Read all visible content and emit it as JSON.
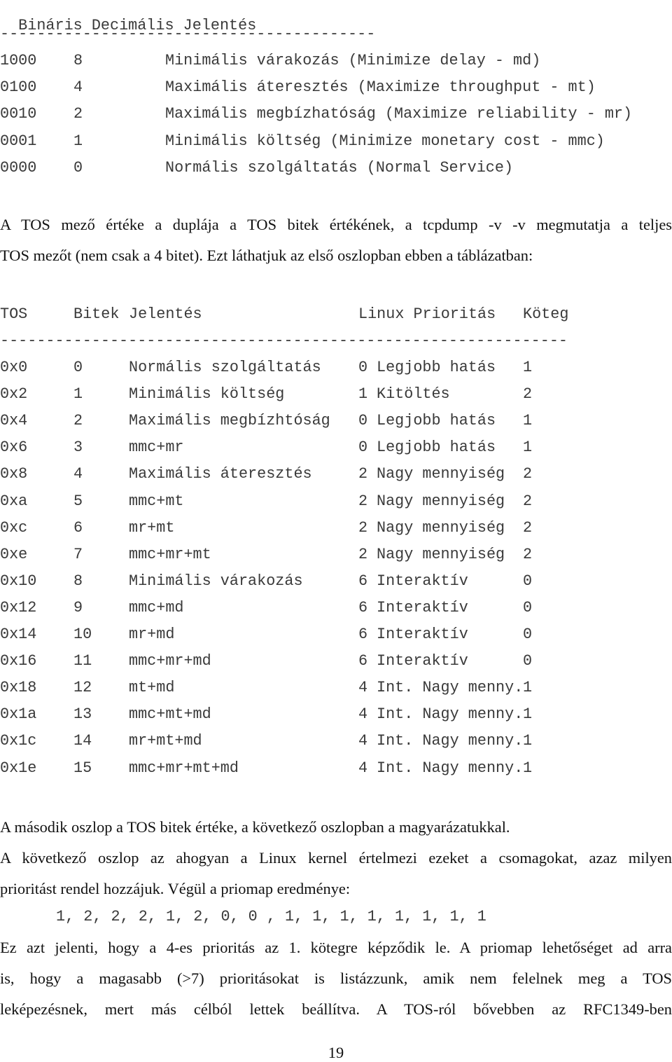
{
  "table1": {
    "headers": [
      "Bináris",
      "Decimális",
      "Jelentés"
    ],
    "separator": "-----------------------------------------",
    "rows": [
      {
        "binary": "1000",
        "decimal": "8",
        "meaning": "Minimális várakozás (Minimize delay - md)"
      },
      {
        "binary": "0100",
        "decimal": "4",
        "meaning": "Maximális áteresztés (Maximize throughput - mt)"
      },
      {
        "binary": "0010",
        "decimal": "2",
        "meaning": "Maximális megbízhatóság (Maximize reliability - mr)"
      },
      {
        "binary": "0001",
        "decimal": "1",
        "meaning": "Minimális költség (Minimize monetary cost - mmc)"
      },
      {
        "binary": "0000",
        "decimal": "0",
        "meaning": "Normális szolgáltatás (Normal Service)"
      }
    ]
  },
  "paragraph1": {
    "line1": "A TOS mező értéke a duplája a TOS bitek értékének, a tcpdump -v -v megmutatja a teljes",
    "line2": "TOS mezőt (nem csak a 4 bitet). Ezt láthatjuk az első oszlopban ebben a táblázatban:"
  },
  "table2": {
    "headers": {
      "tos": "TOS",
      "bits": "Bitek",
      "meaning": "Jelentés",
      "priority": "Linux Prioritás",
      "band": "Köteg"
    },
    "separator": "--------------------------------------------------------------",
    "rows": [
      {
        "tos": "0x0",
        "bits": "0",
        "meaning": "Normális szolgáltatás",
        "prio": "0",
        "prio_name": "Legjobb hatás",
        "band": "1"
      },
      {
        "tos": "0x2",
        "bits": "1",
        "meaning": "Minimális költség",
        "prio": "1",
        "prio_name": "Kitöltés",
        "band": "2"
      },
      {
        "tos": "0x4",
        "bits": "2",
        "meaning": "Maximális megbízhtóság",
        "prio": "0",
        "prio_name": "Legjobb hatás",
        "band": "1"
      },
      {
        "tos": "0x6",
        "bits": "3",
        "meaning": "mmc+mr",
        "prio": "0",
        "prio_name": "Legjobb hatás",
        "band": "1"
      },
      {
        "tos": "0x8",
        "bits": "4",
        "meaning": "Maximális áteresztés",
        "prio": "2",
        "prio_name": "Nagy mennyiség",
        "band": "2"
      },
      {
        "tos": "0xa",
        "bits": "5",
        "meaning": "mmc+mt",
        "prio": "2",
        "prio_name": "Nagy mennyiség",
        "band": "2"
      },
      {
        "tos": "0xc",
        "bits": "6",
        "meaning": "mr+mt",
        "prio": "2",
        "prio_name": "Nagy mennyiség",
        "band": "2"
      },
      {
        "tos": "0xe",
        "bits": "7",
        "meaning": "mmc+mr+mt",
        "prio": "2",
        "prio_name": "Nagy mennyiség",
        "band": "2"
      },
      {
        "tos": "0x10",
        "bits": "8",
        "meaning": "Minimális várakozás",
        "prio": "6",
        "prio_name": "Interaktív",
        "band": "0"
      },
      {
        "tos": "0x12",
        "bits": "9",
        "meaning": "mmc+md",
        "prio": "6",
        "prio_name": "Interaktív",
        "band": "0"
      },
      {
        "tos": "0x14",
        "bits": "10",
        "meaning": "mr+md",
        "prio": "6",
        "prio_name": "Interaktív",
        "band": "0"
      },
      {
        "tos": "0x16",
        "bits": "11",
        "meaning": "mmc+mr+md",
        "prio": "6",
        "prio_name": "Interaktív",
        "band": "0"
      },
      {
        "tos": "0x18",
        "bits": "12",
        "meaning": "mt+md",
        "prio": "4",
        "prio_name": "Int. Nagy menny.",
        "band": "1"
      },
      {
        "tos": "0x1a",
        "bits": "13",
        "meaning": "mmc+mt+md",
        "prio": "4",
        "prio_name": "Int. Nagy menny.",
        "band": "1"
      },
      {
        "tos": "0x1c",
        "bits": "14",
        "meaning": "mr+mt+md",
        "prio": "4",
        "prio_name": "Int. Nagy menny.",
        "band": "1"
      },
      {
        "tos": "0x1e",
        "bits": "15",
        "meaning": "mmc+mr+mt+md",
        "prio": "4",
        "prio_name": "Int. Nagy menny.",
        "band": "1"
      }
    ]
  },
  "paragraph2": {
    "line1": "A második oszlop a TOS bitek értéke, a következő oszlopban a magyarázatukkal.",
    "line2": "A következő oszlop az ahogyan a Linux kernel értelmezi ezeket a csomagokat, azaz milyen",
    "line3": "prioritást rendel hozzájuk. Végül a priomap eredménye:"
  },
  "priomap": "1, 2, 2, 2, 1, 2, 0, 0 , 1, 1, 1, 1, 1, 1, 1, 1",
  "paragraph3": {
    "line1": "Ez azt jelenti, hogy a 4-es prioritás az 1. kötegre képződik le. A priomap lehetőséget ad arra",
    "line2": "is, hogy a magasabb (>7) prioritásokat is listázzunk, amik nem felelnek meg a TOS",
    "line3": "leképezésnek, mert más célból lettek beállítva. A TOS-ról bővebben az RFC1349-ben"
  },
  "page_number": "19"
}
